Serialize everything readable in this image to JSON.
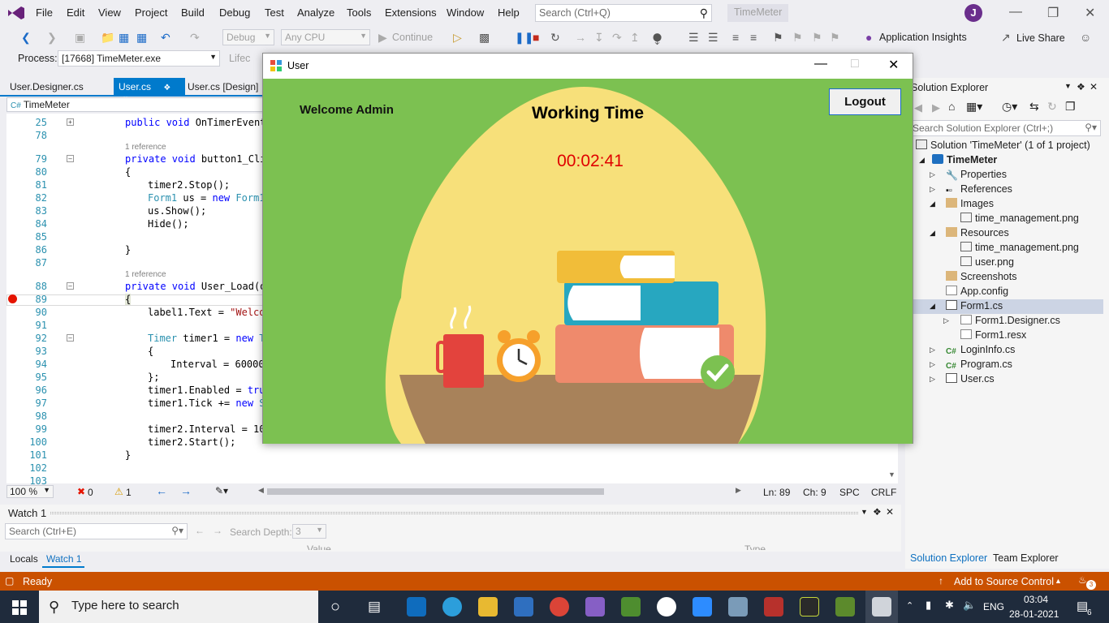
{
  "menubar": {
    "items": [
      "File",
      "Edit",
      "View",
      "Project",
      "Build",
      "Debug",
      "Test",
      "Analyze",
      "Tools",
      "Extensions",
      "Window",
      "Help"
    ],
    "search_placeholder": "Search (Ctrl+Q)",
    "solution_name": "TimeMeter",
    "avatar_initial": "J"
  },
  "toolbar": {
    "config": "Debug",
    "platform": "Any CPU",
    "continue_label": "Continue",
    "app_insights": "Application Insights",
    "live_share": "Live Share"
  },
  "process_bar": {
    "label": "Process:",
    "value": "[17668] TimeMeter.exe",
    "lifecycle": "Lifec"
  },
  "tabs": [
    {
      "label": "User.Designer.cs"
    },
    {
      "label": "User.cs"
    },
    {
      "label": "User.cs [Design]"
    }
  ],
  "editor": {
    "nav_class": "TimeMeter",
    "references_label": "1 reference",
    "zoom": "100 %",
    "errors": "0",
    "warnings": "1",
    "line": "Ln: 89",
    "col": "Ch: 9",
    "spc": "SPC",
    "crlf": "CRLF",
    "line_numbers": [
      "25",
      "78",
      "79",
      "80",
      "81",
      "82",
      "83",
      "84",
      "85",
      "86",
      "87",
      "88",
      "89",
      "90",
      "91",
      "92",
      "93",
      "94",
      "95",
      "96",
      "97",
      "98",
      "99",
      "100",
      "101",
      "102",
      "103"
    ]
  },
  "code": {
    "l25": "public void OnTimerEvent",
    "l79a": "private void ",
    "l79b": "button1_Cli",
    "l80": "{",
    "l81": "timer2.Stop();",
    "l82a": "Form1",
    "l82b": " us = ",
    "l82c": "new",
    "l82d": " Form1",
    "l83": "us.Show();",
    "l84": "Hide();",
    "l86": "}",
    "l88a": "private void ",
    "l88b": "User_Load(ob",
    "l89": "{",
    "l90a": "label1.Text = ",
    "l90b": "\"Welco",
    "l92a": "Timer",
    "l92b": " timer1 = ",
    "l92c": "new",
    "l92d": " T",
    "l93": "{",
    "l94": "Interval = 60000",
    "l95": "};",
    "l96a": "timer1.Enabled = ",
    "l96b": "tru",
    "l97a": "timer1.Tick += ",
    "l97b": "new",
    "l97c": " S",
    "l99": "timer2.Interval = 10",
    "l100": "timer2.Start();",
    "l101": "}"
  },
  "watch": {
    "title": "Watch 1",
    "search_placeholder": "Search (Ctrl+E)",
    "search_depth_label": "Search Depth:",
    "search_depth_value": "3",
    "col_value": "Value",
    "col_type": "Type"
  },
  "bottom_tabs": [
    "Locals",
    "Watch 1"
  ],
  "solution_explorer": {
    "title": "Solution Explorer",
    "search_placeholder": "Search Solution Explorer (Ctrl+;)",
    "tree": [
      {
        "label": "Solution 'TimeMeter' (1 of 1 project)",
        "level": 0
      },
      {
        "label": "TimeMeter",
        "level": 1
      },
      {
        "label": "Properties",
        "level": 2
      },
      {
        "label": "References",
        "level": 2
      },
      {
        "label": "Images",
        "level": 2
      },
      {
        "label": "time_management.png",
        "level": 3
      },
      {
        "label": "Resources",
        "level": 2
      },
      {
        "label": "time_management.png",
        "level": 3
      },
      {
        "label": "user.png",
        "level": 3
      },
      {
        "label": "Screenshots",
        "level": 2
      },
      {
        "label": "App.config",
        "level": 2
      },
      {
        "label": "Form1.cs",
        "level": 2
      },
      {
        "label": "Form1.Designer.cs",
        "level": 3
      },
      {
        "label": "Form1.resx",
        "level": 3
      },
      {
        "label": "LoginInfo.cs",
        "level": 2
      },
      {
        "label": "Program.cs",
        "level": 2
      },
      {
        "label": "User.cs",
        "level": 2
      }
    ],
    "tab_solution": "Solution Explorer",
    "tab_team": "Team Explorer"
  },
  "statusbar": {
    "ready": "Ready",
    "source_control": "Add to Source Control",
    "notifications": "3"
  },
  "dialog": {
    "title": "User",
    "welcome": "Welcome  Admin",
    "logout": "Logout",
    "heading": "Working Time",
    "timer": "00:02:41"
  },
  "taskbar": {
    "search_placeholder": "Type here to search",
    "lang": "ENG",
    "time": "03:04",
    "date": "28-01-2021",
    "notif_count": "6"
  },
  "colors": {
    "accent": "#007acc",
    "status_bar": "#ca5100",
    "form_bg": "#7cc151",
    "timer_red": "#e00000"
  }
}
